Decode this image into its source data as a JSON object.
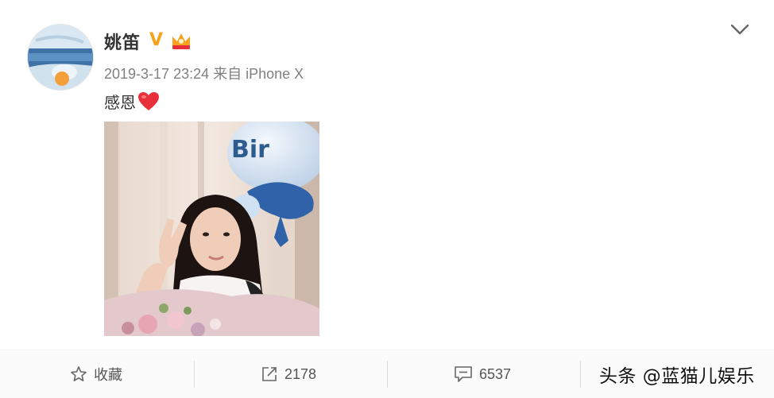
{
  "post": {
    "username": "姚笛",
    "verified_badge": "V",
    "timestamp": "2019-3-17 23:24",
    "source": "来自 iPhone X",
    "text": "感恩",
    "emoji": "heart-emoji"
  },
  "toolbar": {
    "favorite_label": "收藏",
    "repost_count": "2178",
    "comment_count": "6537"
  },
  "watermark": "头条 @蓝猫儿娱乐",
  "colors": {
    "badge_orange": "#f6a21e",
    "heart_red": "#e8303a",
    "meta_gray": "#808080"
  }
}
